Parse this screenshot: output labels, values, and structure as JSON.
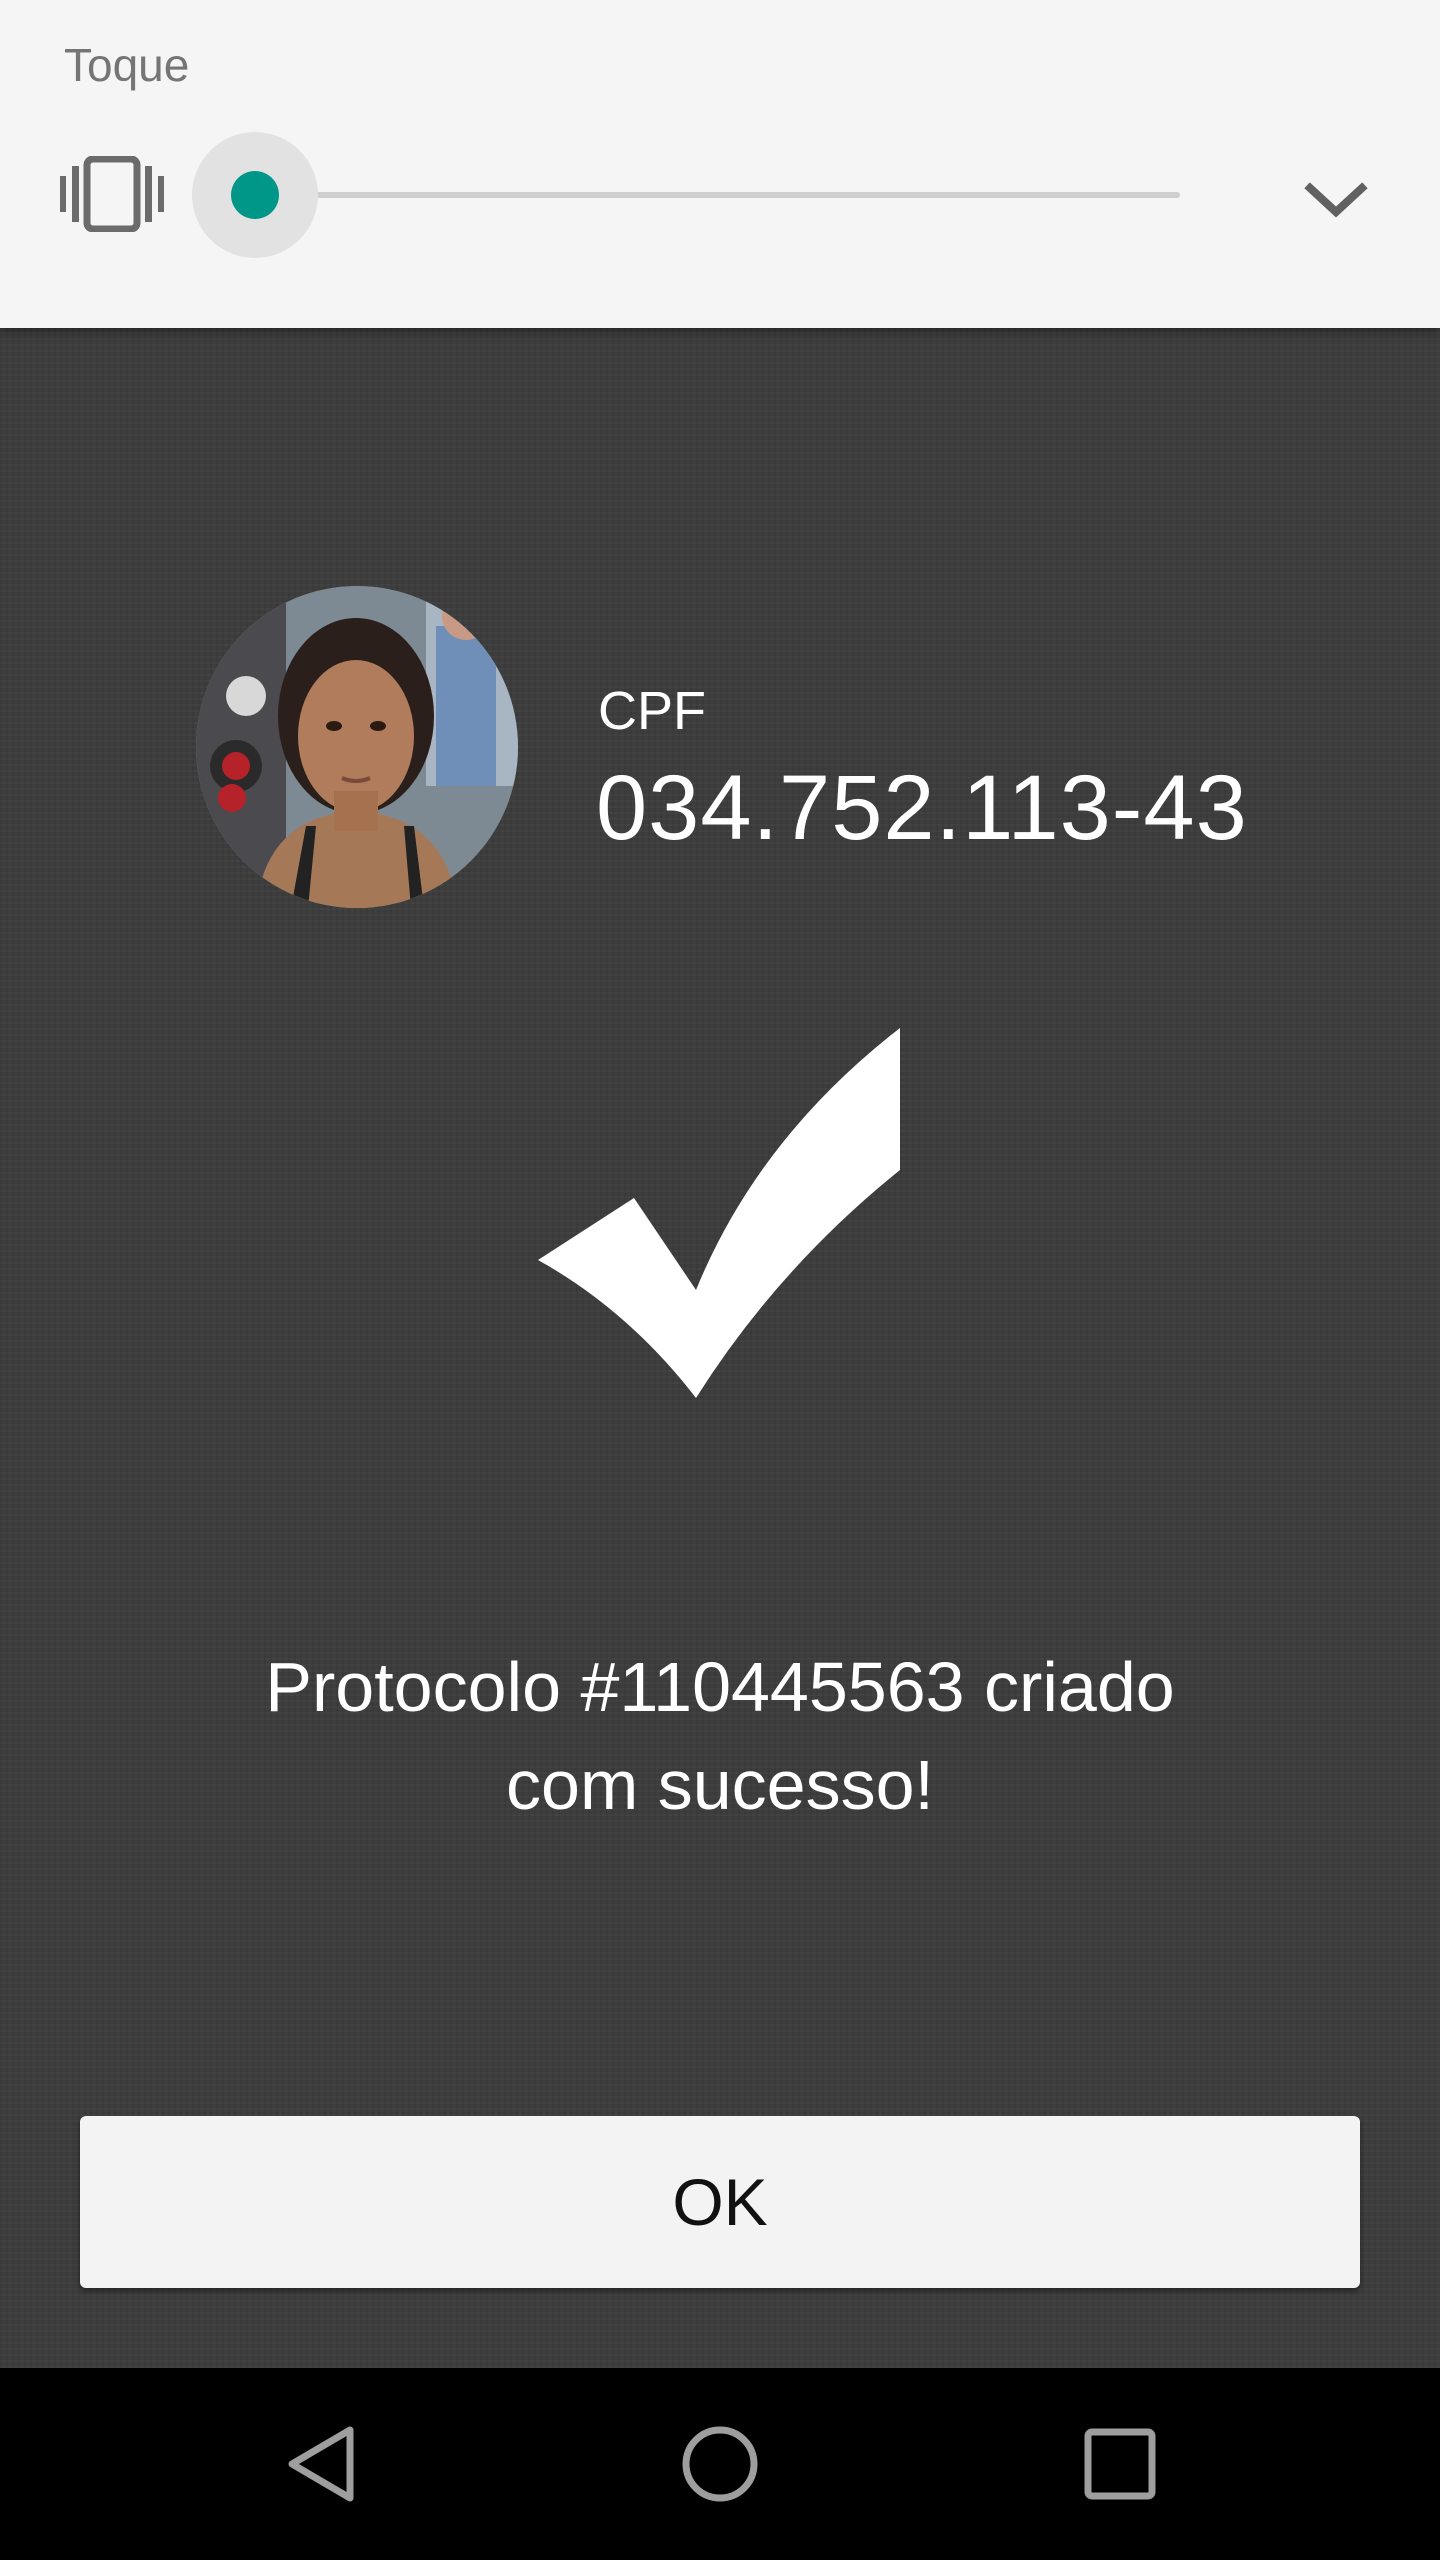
{
  "volume_panel": {
    "title": "Toque",
    "icon": "vibrate-icon",
    "slider_level_percent": 0,
    "accent_color": "#009688",
    "expand_icon": "chevron-down-icon"
  },
  "dialog": {
    "cpf_label": "CPF",
    "cpf_value": "034.752.113-43",
    "status_icon": "checkmark-icon",
    "message_line1": "Protocolo #110445563 criado",
    "message_line2": "com sucesso!",
    "ok_label": "OK"
  },
  "navbar": {
    "back_icon": "back-triangle-icon",
    "home_icon": "home-circle-icon",
    "recents_icon": "recents-square-icon"
  }
}
